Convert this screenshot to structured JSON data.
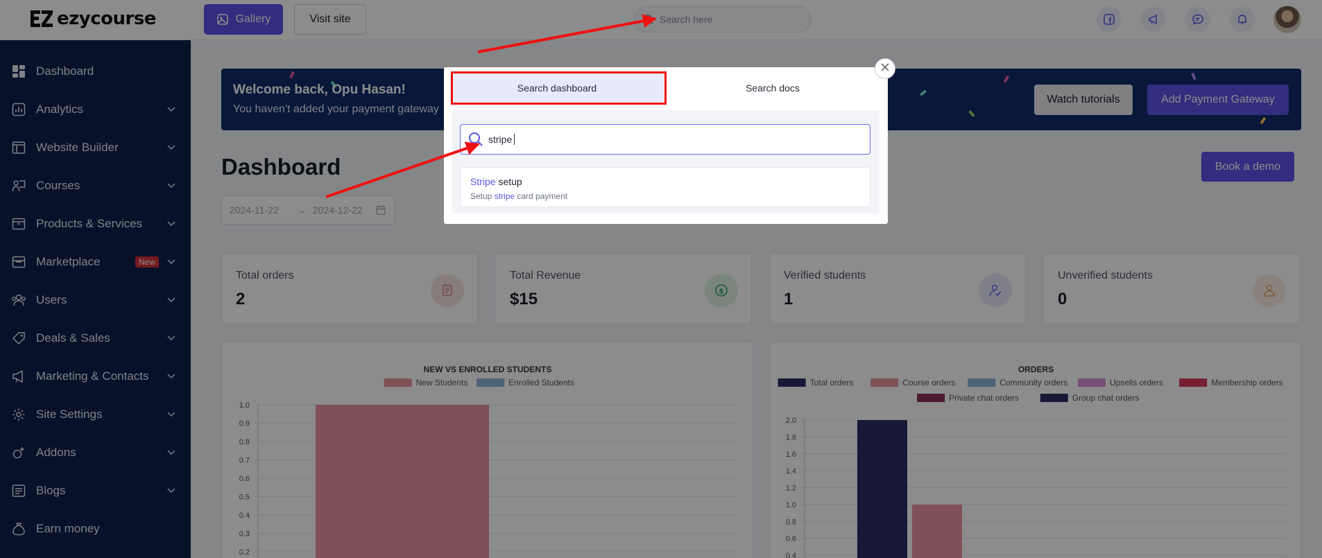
{
  "brand": {
    "name": "ezycourse"
  },
  "topbar": {
    "gallery_label": "Gallery",
    "visit_label": "Visit site",
    "search_placeholder": "Search here"
  },
  "sidebar": {
    "items": [
      {
        "label": "Dashboard",
        "icon": "grid-icon"
      },
      {
        "label": "Analytics",
        "icon": "chart-icon"
      },
      {
        "label": "Website Builder",
        "icon": "layout-icon"
      },
      {
        "label": "Courses",
        "icon": "teacher-icon"
      },
      {
        "label": "Products & Services",
        "icon": "box-icon"
      },
      {
        "label": "Marketplace",
        "icon": "store-icon",
        "badge": "New"
      },
      {
        "label": "Users",
        "icon": "users-icon"
      },
      {
        "label": "Deals & Sales",
        "icon": "tag-icon"
      },
      {
        "label": "Marketing & Contacts",
        "icon": "megaphone-icon"
      },
      {
        "label": "Site Settings",
        "icon": "gear-icon"
      },
      {
        "label": "Addons",
        "icon": "addon-icon"
      },
      {
        "label": "Blogs",
        "icon": "blog-icon"
      },
      {
        "label": "Earn money",
        "icon": "moneybag-icon"
      }
    ]
  },
  "banner": {
    "title": "Welcome back, Opu Hasan!",
    "subtitle": "You haven't added your payment gateway",
    "watch_label": "Watch tutorials",
    "add_payment_label": "Add Payment Gateway"
  },
  "page": {
    "title": "Dashboard",
    "date_from": "2024-11-22",
    "date_sep": "→",
    "date_to": "2024-12-22",
    "demo_label": "Book a demo"
  },
  "stats": [
    {
      "label": "Total orders",
      "value": "2",
      "icon": "receipt-icon",
      "color": "#f7e3e3"
    },
    {
      "label": "Total Revenue",
      "value": "$15",
      "icon": "dollar-icon",
      "color": "#dff3e6"
    },
    {
      "label": "Verified students",
      "value": "1",
      "icon": "verified-user-icon",
      "color": "#e8e7fb"
    },
    {
      "label": "Unverified students",
      "value": "0",
      "icon": "user-icon",
      "color": "#fbeee4"
    }
  ],
  "chart_data": [
    {
      "type": "bar",
      "title": "NEW VS ENROLLED STUDENTS",
      "categories": [
        ""
      ],
      "series": [
        {
          "name": "New Students",
          "values": [
            1.0
          ],
          "color": "#e8949f"
        },
        {
          "name": "Enrolled Students",
          "values": [
            0
          ],
          "color": "#8fb3d6"
        }
      ],
      "yticks": [
        "1.0",
        "0.9",
        "0.8",
        "0.7",
        "0.6",
        "0.5",
        "0.4",
        "0.3",
        "0.2"
      ],
      "ylim": [
        0,
        1.0
      ],
      "legend": "top"
    },
    {
      "type": "bar",
      "title": "ORDERS",
      "categories": [
        ""
      ],
      "series": [
        {
          "name": "Total orders",
          "values": [
            2
          ],
          "color": "#2d2e64"
        },
        {
          "name": "Course orders",
          "values": [
            1
          ],
          "color": "#e8949f"
        },
        {
          "name": "Community orders",
          "values": [
            0
          ],
          "color": "#8fb3d6"
        },
        {
          "name": "Upsells orders",
          "values": [
            0
          ],
          "color": "#d98fd9"
        },
        {
          "name": "Membership orders",
          "values": [
            0
          ],
          "color": "#d93a5c"
        },
        {
          "name": "Private chat orders",
          "values": [
            0
          ],
          "color": "#8f2f5c"
        },
        {
          "name": "Group chat orders",
          "values": [
            0
          ],
          "color": "#2d2e64"
        }
      ],
      "yticks": [
        "2.0",
        "1.8",
        "1.6",
        "1.4",
        "1.2",
        "1.0",
        "0.8",
        "0.6",
        "0.4"
      ],
      "ylim": [
        0,
        2.0
      ],
      "legend": "top"
    }
  ],
  "modal": {
    "tab_dashboard": "Search dashboard",
    "tab_docs": "Search docs",
    "search_value": "stripe",
    "result_title_hl": "Stripe",
    "result_title_rest": " setup",
    "result_sub_pre": "Setup ",
    "result_sub_hl": "stripe",
    "result_sub_post": " card payment"
  }
}
